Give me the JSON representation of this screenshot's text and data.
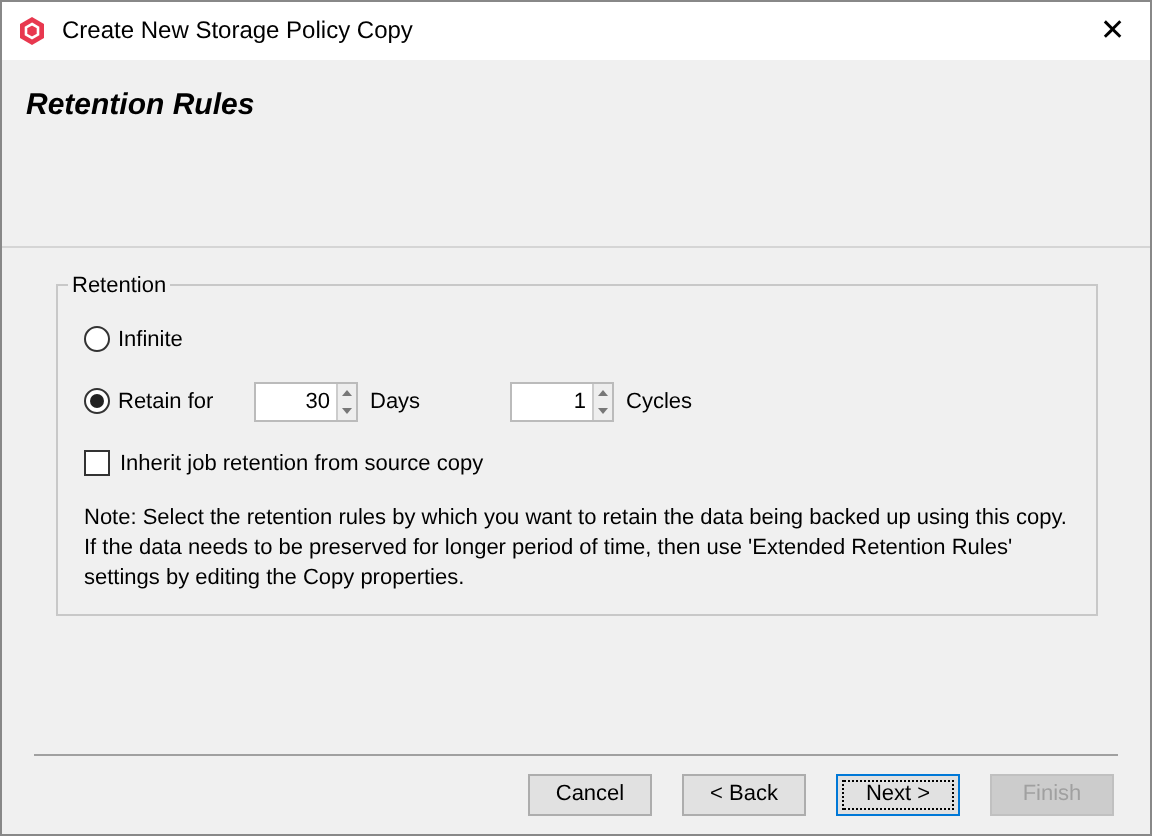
{
  "window": {
    "title": "Create New Storage Policy Copy",
    "close": "✕"
  },
  "header": {
    "title": "Retention Rules"
  },
  "retention": {
    "legend": "Retention",
    "options": [
      {
        "kind": "plain",
        "label": "Infinite",
        "selected": false
      },
      {
        "kind": "spinners",
        "label": "Retain for",
        "selected": true
      }
    ],
    "days": {
      "value": "30",
      "unit": "Days"
    },
    "cycles": {
      "value": "1",
      "unit": "Cycles"
    },
    "inherit": {
      "label": "Inherit job retention from source copy",
      "checked": false
    },
    "note": "Note: Select the retention rules by which you want to retain the data being backed up using this copy. If the data needs to be preserved for longer period of time, then use 'Extended Retention Rules' settings by editing the Copy properties."
  },
  "buttons": [
    {
      "label": "Cancel",
      "disabled": false,
      "default": false
    },
    {
      "label": "< Back",
      "disabled": false,
      "default": false
    },
    {
      "label": "Next >",
      "disabled": false,
      "default": true
    },
    {
      "label": "Finish",
      "disabled": true,
      "default": false
    }
  ]
}
